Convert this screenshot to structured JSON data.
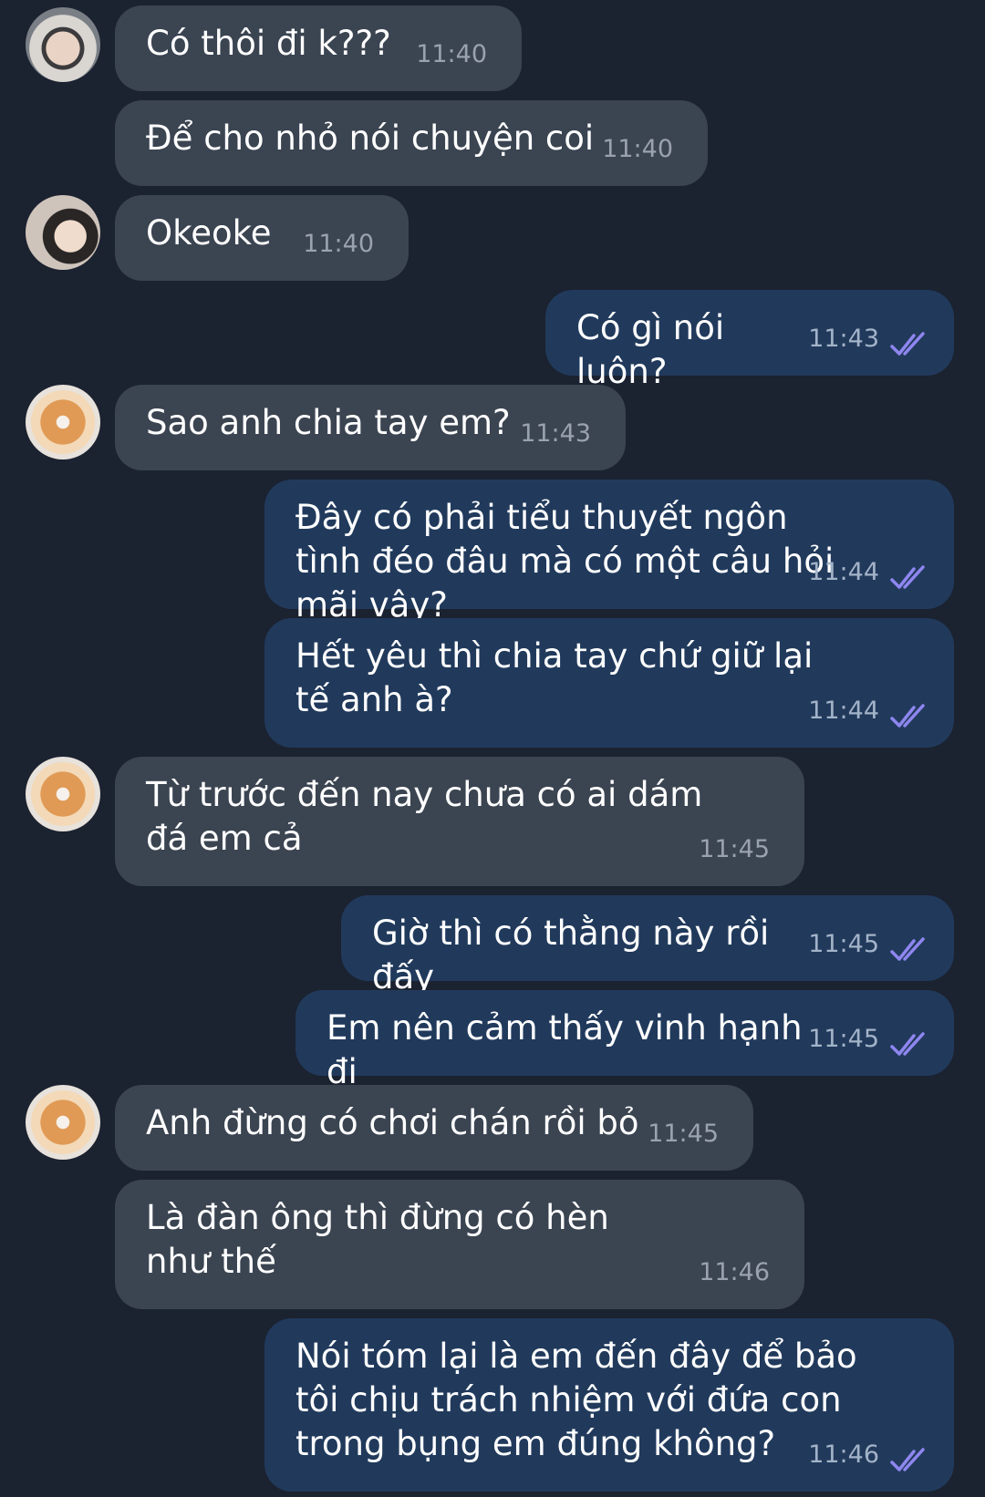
{
  "messages": [
    {
      "text": "Có thôi đi k???",
      "time": "11:40"
    },
    {
      "text": "Để cho nhỏ nói chuyện coi",
      "time": "11:40"
    },
    {
      "text": "Okeoke",
      "time": "11:40"
    },
    {
      "text": "Có gì nói luôn?",
      "time": "11:43"
    },
    {
      "text": "Sao anh chia tay em?",
      "time": "11:43"
    },
    {
      "text": "Đây có phải tiểu thuyết ngôn tình đéo đâu mà có một câu hỏi mãi vậy?",
      "time": "11:44"
    },
    {
      "text": "Hết yêu thì chia tay chứ giữ lại tế anh à?",
      "time": "11:44"
    },
    {
      "text": "Từ trước đến nay chưa có ai dám đá em cả",
      "time": "11:45"
    },
    {
      "text": "Giờ thì có thằng này rồi đấy",
      "time": "11:45"
    },
    {
      "text": "Em nên cảm thấy vinh hạnh đi",
      "time": "11:45"
    },
    {
      "text": "Anh đừng có chơi chán rồi bỏ",
      "time": "11:45"
    },
    {
      "text": "Là đàn ông thì đừng có hèn như thế",
      "time": "11:46"
    },
    {
      "text": "Nói tóm lại là em đến đây để bảo tôi chịu trách nhiệm với đứa con trong bụng em đúng không?",
      "time": "11:46"
    }
  ],
  "icons": {
    "read_receipt": "double-check-icon",
    "avatar": "avatar"
  },
  "colors": {
    "background": "#1b2230",
    "incoming": "#3b4451",
    "outgoing": "#213a5c",
    "ticks": "#8f86f0"
  }
}
